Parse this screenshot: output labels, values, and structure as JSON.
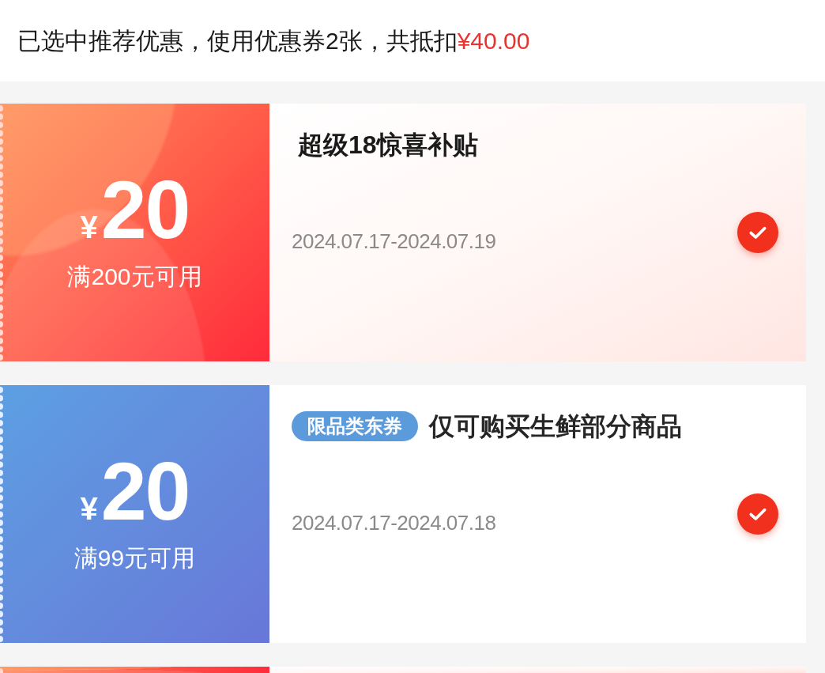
{
  "header": {
    "summary": "已选中推荐优惠，使用优惠券2张，共抵扣",
    "discount": "¥40.00"
  },
  "coupons": [
    {
      "kind": "subsidy",
      "currency": "¥",
      "amount": "20",
      "condition": "满200元可用",
      "title": "超级18惊喜补贴",
      "validity": "2024.07.17-2024.07.19",
      "selected": true
    },
    {
      "kind": "category",
      "currency": "¥",
      "amount": "20",
      "condition": "满99元可用",
      "tag": "限品类东券",
      "title": "仅可购买生鲜部分商品",
      "validity": "2024.07.17-2024.07.18",
      "selected": true
    },
    {
      "kind": "subsidy"
    }
  ]
}
